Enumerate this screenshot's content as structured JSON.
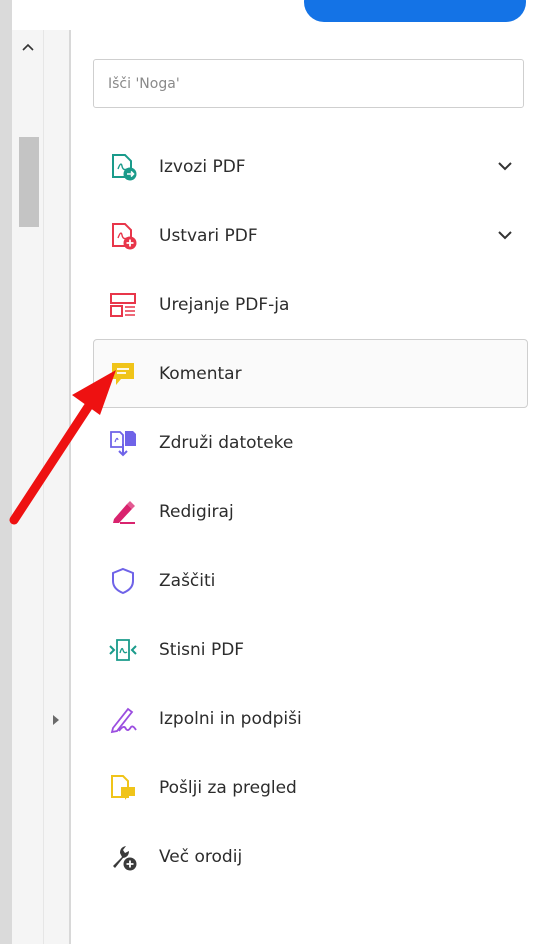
{
  "search": {
    "placeholder": "Išči 'Noga'"
  },
  "tools": [
    {
      "label": "Izvozi PDF",
      "icon": "export-pdf-icon",
      "expandable": true
    },
    {
      "label": "Ustvari PDF",
      "icon": "create-pdf-icon",
      "expandable": true
    },
    {
      "label": "Urejanje PDF-ja",
      "icon": "edit-pdf-icon"
    },
    {
      "label": "Komentar",
      "icon": "comment-icon",
      "selected": true
    },
    {
      "label": "Združi datoteke",
      "icon": "combine-files-icon"
    },
    {
      "label": "Redigiraj",
      "icon": "redact-icon"
    },
    {
      "label": "Zaščiti",
      "icon": "protect-shield-icon"
    },
    {
      "label": "Stisni PDF",
      "icon": "compress-pdf-icon"
    },
    {
      "label": "Izpolni in podpiši",
      "icon": "fill-sign-icon"
    },
    {
      "label": "Pošlji za pregled",
      "icon": "send-review-icon"
    },
    {
      "label": "Več orodij",
      "icon": "more-tools-icon"
    }
  ],
  "colors": {
    "export": "#1a9b8b",
    "create": "#e8364a",
    "edit": "#e8364a",
    "comment": "#f0c419",
    "combine": "#6f63e8",
    "redact": "#d9236e",
    "protect": "#6f63e8",
    "compress": "#1a9b8b",
    "fill_sign": "#9b4ee0",
    "send_review": "#f0c419",
    "more_tools": "#3a3a3a",
    "annotation_arrow": "#ee1111"
  }
}
